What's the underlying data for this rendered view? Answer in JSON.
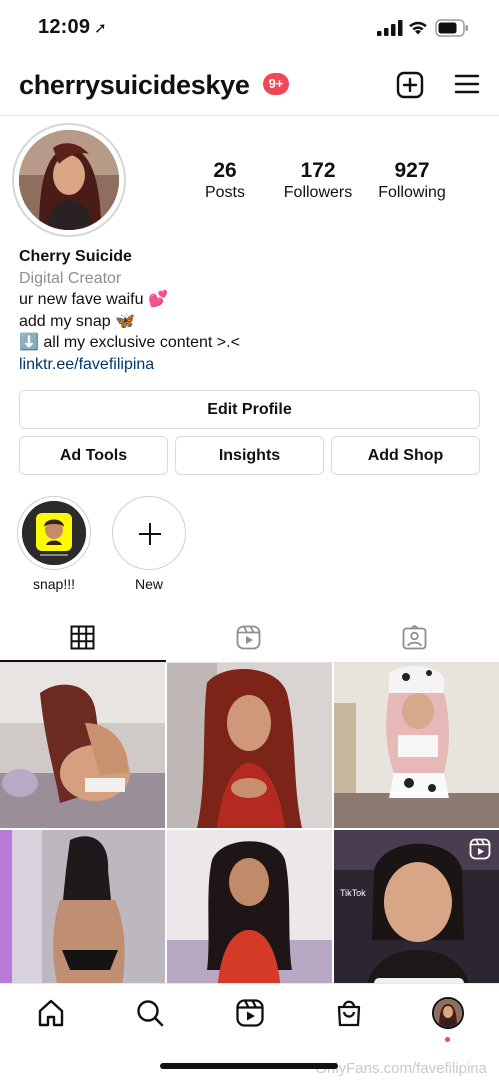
{
  "status_bar": {
    "time": "12:09",
    "location_arrow": "➚"
  },
  "header": {
    "username": "cherrysuicideskye",
    "notification_badge": "9+"
  },
  "profile": {
    "stats": {
      "posts_count": "26",
      "posts_label": "Posts",
      "followers_count": "172",
      "followers_label": "Followers",
      "following_count": "927",
      "following_label": "Following"
    },
    "bio": {
      "name": "Cherry Suicide",
      "category": "Digital Creator",
      "line1": "ur new fave waifu 💕",
      "line2": "add my snap 🦋",
      "line3": "⬇️ all my exclusive content >.<",
      "link": "linktr.ee/favefilipina"
    }
  },
  "buttons": {
    "edit_profile": "Edit Profile",
    "ad_tools": "Ad Tools",
    "insights": "Insights",
    "add_shop": "Add Shop"
  },
  "highlights": [
    {
      "label": "snap!!!"
    },
    {
      "label": "New"
    }
  ],
  "tabs": [
    {
      "icon": "grid-icon",
      "active": true
    },
    {
      "icon": "reels-icon",
      "active": false
    },
    {
      "icon": "tagged-icon",
      "active": false
    }
  ],
  "grid": {
    "tiktok_label": "TikTok"
  },
  "bottom_nav": [
    {
      "icon": "home-icon"
    },
    {
      "icon": "search-icon"
    },
    {
      "icon": "reels-icon"
    },
    {
      "icon": "shop-icon"
    },
    {
      "icon": "profile-avatar"
    }
  ],
  "watermark": "OnlyFans.com/favefilipina",
  "colors": {
    "badge": "#ed4956",
    "link": "#00376b",
    "muted": "#8e8e8e",
    "border": "#dbdbdb"
  }
}
